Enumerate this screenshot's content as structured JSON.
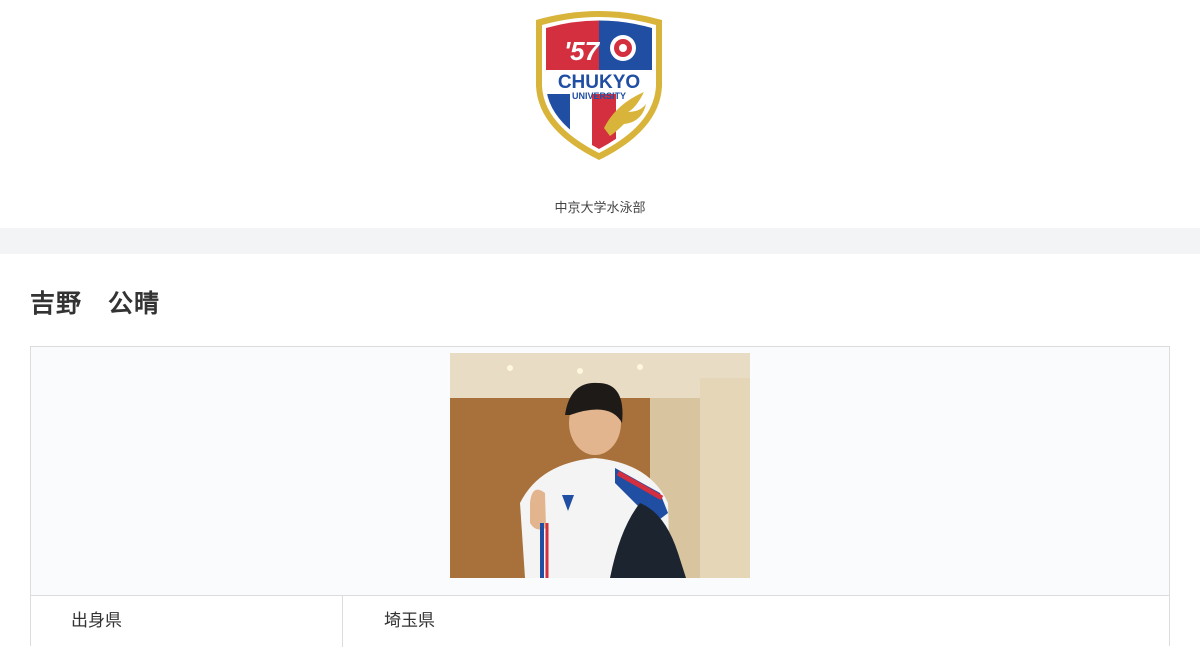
{
  "header": {
    "logo": {
      "year_text": "'57",
      "main_text": "CHUKYO",
      "sub_text": "UNIVERSITY",
      "colors": {
        "red": "#d32f3f",
        "blue": "#1f4ea3",
        "gold": "#d9b43a",
        "white": "#ffffff"
      }
    },
    "site_name": "中京大学水泳部"
  },
  "player": {
    "name": "吉野　公晴"
  },
  "profile": {
    "photo_icon": "player-photo",
    "rows": [
      {
        "label": "出身県",
        "value": "埼玉県"
      }
    ]
  }
}
